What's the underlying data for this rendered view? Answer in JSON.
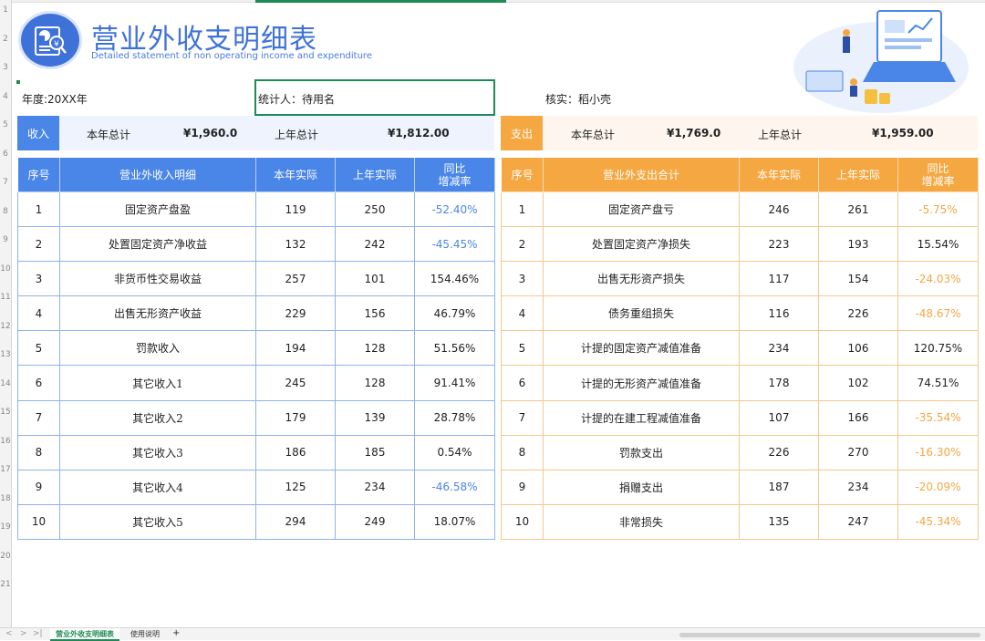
{
  "header": {
    "title": "营业外收支明细表",
    "subtitle": "Detailed statement of non operating income and expenditure"
  },
  "info": {
    "year": "年度:20XX年",
    "statistician": "统计人：待用名",
    "checker": "核实：稻小壳"
  },
  "income_summary": {
    "tag": "收入",
    "this_year_label": "本年总计",
    "this_year_value": "¥1,960.0",
    "last_year_label": "上年总计",
    "last_year_value": "¥1,812.00"
  },
  "expense_summary": {
    "tag": "支出",
    "this_year_label": "本年总计",
    "this_year_value": "¥1,769.0",
    "last_year_label": "上年总计",
    "last_year_value": "¥1,959.00"
  },
  "income_table": {
    "headers": [
      "序号",
      "营业外收入明细",
      "本年实际",
      "上年实际",
      "同比",
      "增减率"
    ],
    "rows": [
      {
        "no": "1",
        "name": "固定资产盘盈",
        "cur": "119",
        "prev": "250",
        "rate": "-52.40%"
      },
      {
        "no": "2",
        "name": "处置固定资产净收益",
        "cur": "132",
        "prev": "242",
        "rate": "-45.45%"
      },
      {
        "no": "3",
        "name": "非货币性交易收益",
        "cur": "257",
        "prev": "101",
        "rate": "154.46%"
      },
      {
        "no": "4",
        "name": "出售无形资产收益",
        "cur": "229",
        "prev": "156",
        "rate": "46.79%"
      },
      {
        "no": "5",
        "name": "罚款收入",
        "cur": "194",
        "prev": "128",
        "rate": "51.56%"
      },
      {
        "no": "6",
        "name": "其它收入1",
        "cur": "245",
        "prev": "128",
        "rate": "91.41%"
      },
      {
        "no": "7",
        "name": "其它收入2",
        "cur": "179",
        "prev": "139",
        "rate": "28.78%"
      },
      {
        "no": "8",
        "name": "其它收入3",
        "cur": "186",
        "prev": "185",
        "rate": "0.54%"
      },
      {
        "no": "9",
        "name": "其它收入4",
        "cur": "125",
        "prev": "234",
        "rate": "-46.58%"
      },
      {
        "no": "10",
        "name": "其它收入5",
        "cur": "294",
        "prev": "249",
        "rate": "18.07%"
      }
    ]
  },
  "expense_table": {
    "headers": [
      "序号",
      "营业外支出合计",
      "本年实际",
      "上年实际",
      "同比",
      "增减率"
    ],
    "rows": [
      {
        "no": "1",
        "name": "固定资产盘亏",
        "cur": "246",
        "prev": "261",
        "rate": "-5.75%"
      },
      {
        "no": "2",
        "name": "处置固定资产净损失",
        "cur": "223",
        "prev": "193",
        "rate": "15.54%"
      },
      {
        "no": "3",
        "name": "出售无形资产损失",
        "cur": "117",
        "prev": "154",
        "rate": "-24.03%"
      },
      {
        "no": "4",
        "name": "债务重组损失",
        "cur": "116",
        "prev": "226",
        "rate": "-48.67%"
      },
      {
        "no": "5",
        "name": "计提的固定资产减值准备",
        "cur": "234",
        "prev": "106",
        "rate": "120.75%"
      },
      {
        "no": "6",
        "name": "计提的无形资产减值准备",
        "cur": "178",
        "prev": "102",
        "rate": "74.51%"
      },
      {
        "no": "7",
        "name": "计提的在建工程减值准备",
        "cur": "107",
        "prev": "166",
        "rate": "-35.54%"
      },
      {
        "no": "8",
        "name": "罚款支出",
        "cur": "226",
        "prev": "270",
        "rate": "-16.30%"
      },
      {
        "no": "9",
        "name": "捐赠支出",
        "cur": "187",
        "prev": "234",
        "rate": "-20.09%"
      },
      {
        "no": "10",
        "name": "非常损失",
        "cur": "135",
        "prev": "247",
        "rate": "-45.34%"
      }
    ]
  },
  "sheet_tabs": {
    "active": "营业外收支明细表",
    "other": "使用说明",
    "add": "+",
    "nav_prev": "<",
    "nav_next": ">",
    "nav_last": ">|"
  },
  "row_numbers": [
    "1",
    "2",
    "3",
    "4",
    "5",
    "6",
    "7",
    "8",
    "9",
    "10",
    "11",
    "12",
    "13",
    "14",
    "15",
    "16",
    "17",
    "18",
    "19",
    "20",
    "21"
  ],
  "colors": {
    "income_accent": "#4a86e8",
    "expense_accent": "#f5a742",
    "title_blue": "#3f72d9",
    "selection_green": "#1e8a55"
  },
  "icons": [
    "report-logo-icon",
    "laptop-illustration"
  ]
}
